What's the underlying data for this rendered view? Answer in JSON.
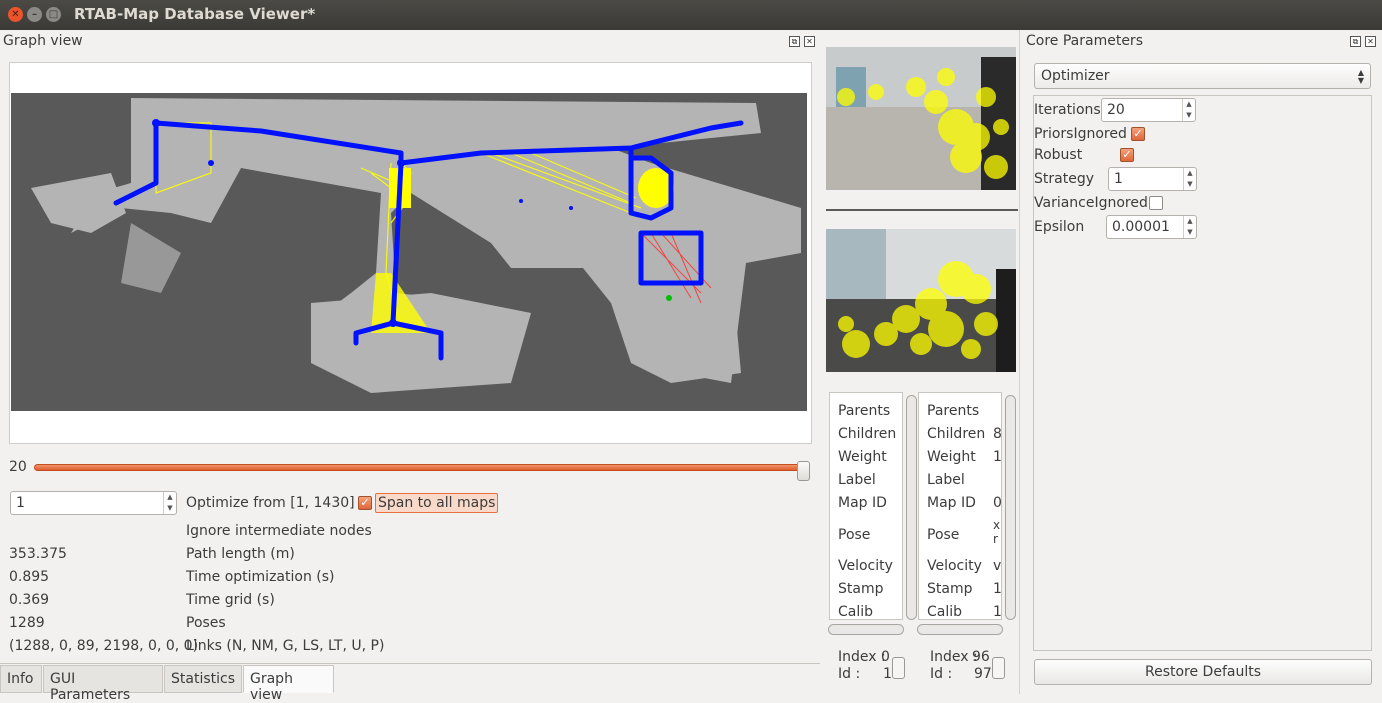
{
  "window": {
    "title": "RTAB-Map Database Viewer*"
  },
  "graph_dock": {
    "title": "Graph view",
    "slider_value": "20",
    "slider_fraction": 1.0,
    "spin_value": "1",
    "optimize_from": "Optimize from [1, 1430]",
    "span_label": "Span to all maps",
    "ignore_label": "Ignore intermediate nodes",
    "stats": [
      {
        "value": "353.375",
        "label": "Path length (m)"
      },
      {
        "value": "0.895",
        "label": "Time optimization (s)"
      },
      {
        "value": "0.369",
        "label": "Time grid (s)"
      },
      {
        "value": "1289",
        "label": "Poses"
      },
      {
        "value": "(1288, 0, 89, 2198, 0, 0, 0)",
        "label": "Links (N, NM, G, LS, LT, U, P)"
      }
    ]
  },
  "tabs": [
    "Info",
    "GUI Parameters",
    "Statistics",
    "Graph view"
  ],
  "info_left": {
    "rows": [
      "Parents",
      "Children",
      "Weight",
      "Label",
      "Map ID",
      "Pose",
      "Velocity",
      "Stamp",
      "Calib"
    ],
    "index_label": "Index :",
    "index_value": "0",
    "id_label": "Id :",
    "id_value": "1"
  },
  "info_right": {
    "rows": [
      "Parents",
      "Children",
      "Weight",
      "Label",
      "Map ID",
      "Pose",
      "Velocity",
      "Stamp",
      "Calib"
    ],
    "values": [
      "",
      "8",
      "1",
      "",
      "0",
      "x\nr",
      "v:",
      "1",
      "1"
    ],
    "index_label": "Index :",
    "index_value": "96",
    "id_label": "Id :",
    "id_value": "97"
  },
  "core": {
    "title": "Core Parameters",
    "selected": "Optimizer",
    "iterations_label": "Iterations",
    "iterations": "20",
    "priors_label": "PriorsIgnored",
    "robust_label": "Robust",
    "strategy_label": "Strategy",
    "strategy": "1",
    "variance_label": "VarianceIgnored",
    "epsilon_label": "Epsilon",
    "epsilon": "0.00001",
    "restore": "Restore Defaults"
  },
  "colors": {
    "accent": "#e8703f",
    "path": "#0000ff",
    "links": "#ffff00",
    "map_bg": "#595959"
  }
}
